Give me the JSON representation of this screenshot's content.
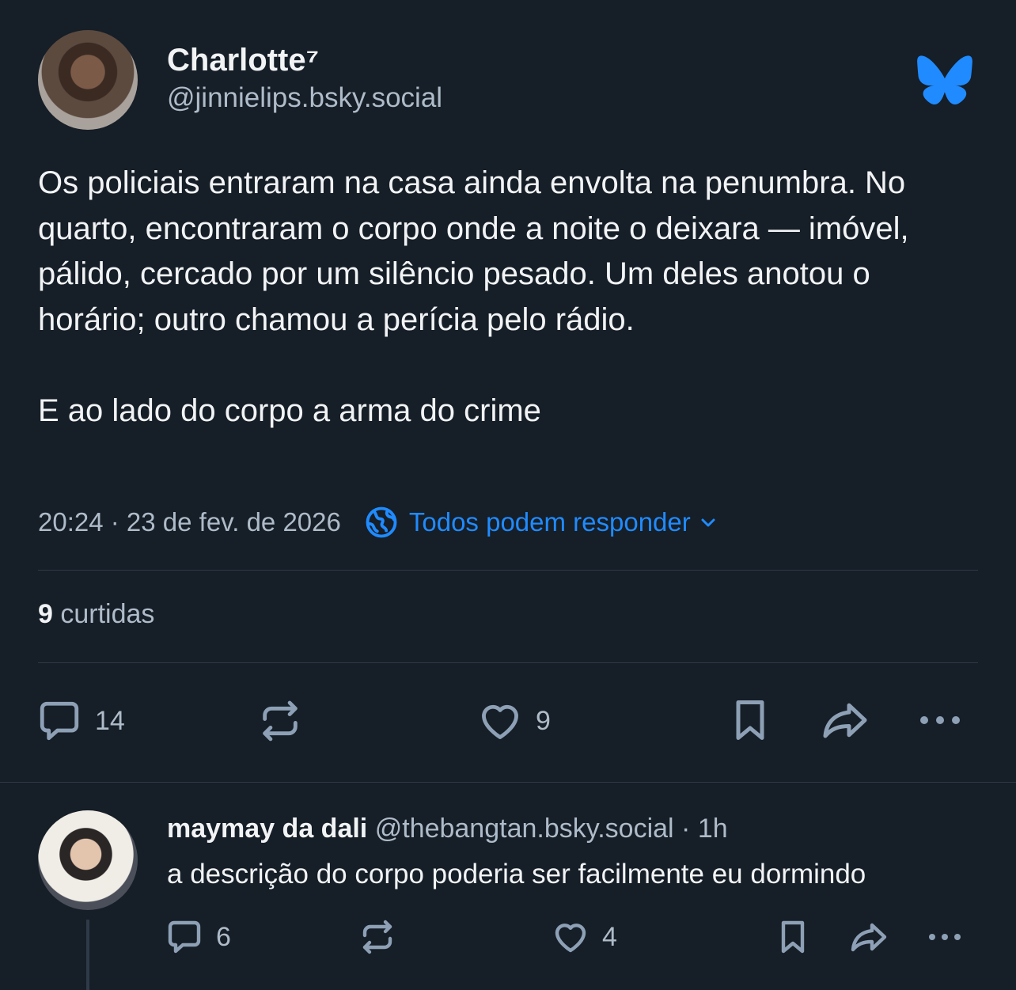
{
  "post": {
    "author": {
      "display_name": "Charlotte⁷",
      "handle": "@jinnielips.bsky.social"
    },
    "paragraphs": [
      "Os policiais entraram na casa ainda envolta na penumbra. No quarto, encontraram o corpo onde a noite o deixara — imóvel, pálido, cercado por um silêncio pesado. Um deles anotou o horário; outro chamou a perícia pelo rádio.",
      "E ao lado do corpo a arma do crime"
    ],
    "timestamp": "20:24 · 23 de fev. de 2026",
    "reply_setting": "Todos podem responder",
    "likes_count": "9",
    "likes_label": "curtidas",
    "actions": {
      "reply_count": "14",
      "like_count": "9"
    }
  },
  "reply": {
    "display_name": "maymay da dali",
    "handle": "@thebangtan.bsky.social",
    "separator": "·",
    "time": "1h",
    "text": "a descrição do corpo poderia ser facilmente eu dormindo",
    "actions": {
      "reply_count": "6",
      "like_count": "4"
    }
  },
  "icons": {
    "brand": "bluesky-butterfly-icon",
    "reply_setting": "globe-icon",
    "reply": "speech-bubble-icon",
    "repost": "repost-icon",
    "like": "heart-icon",
    "bookmark": "bookmark-icon",
    "share": "share-arrow-icon",
    "more": "more-dots-icon"
  },
  "colors": {
    "background": "#161e27",
    "accent": "#208bfe",
    "text_primary": "#f1f3f5",
    "text_secondary": "#aebbc9",
    "icon": "#8da0b5",
    "divider": "#2e3a48"
  }
}
